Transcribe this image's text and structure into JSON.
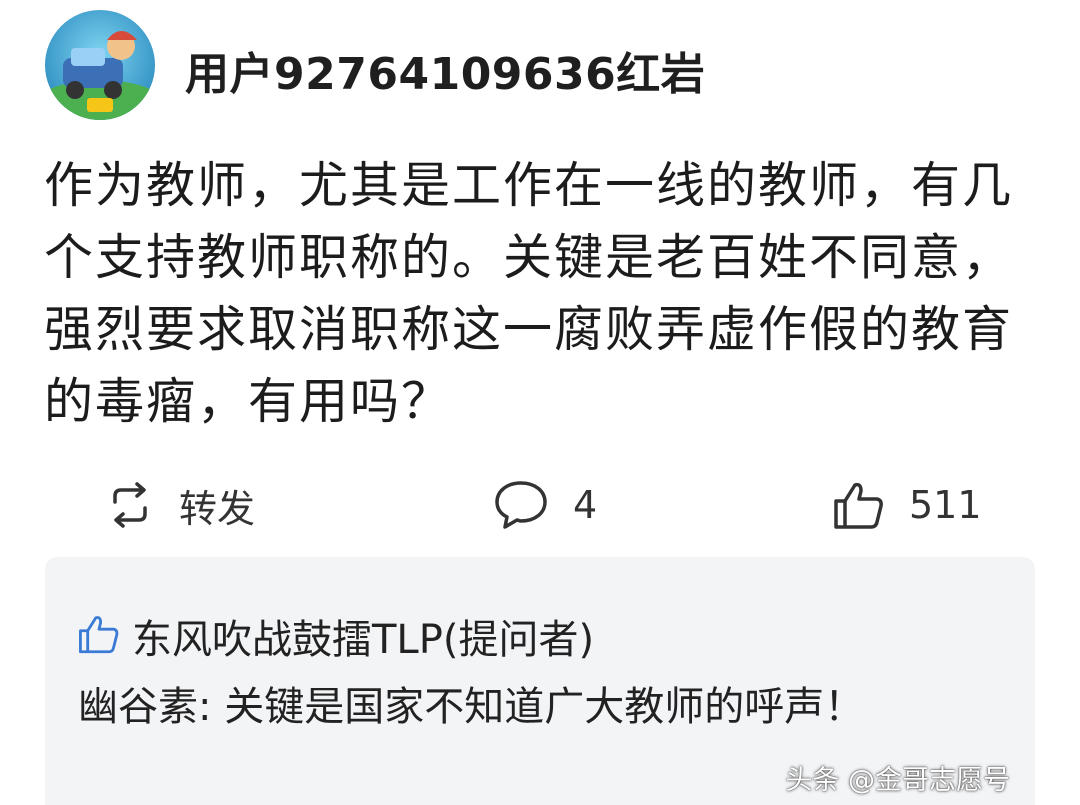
{
  "post": {
    "username": "用户92764109636红岩",
    "text": "作为教师，尤其是工作在一线的教师，有几个支持教师职称的。关键是老百姓不同意，强烈要求取消职称这一腐败弄虚作假的教育的毒瘤，有用吗？"
  },
  "actions": {
    "share_label": "转发",
    "comment_count": "4",
    "like_count": "511"
  },
  "reply": {
    "author": "东风吹战鼓擂TLP(提问者)",
    "text": "幽谷素: 关键是国家不知道广大教师的呼声！"
  },
  "watermark": "头条 @金哥志愿号",
  "colors": {
    "like_icon_blue": "#3a7bd5",
    "card_background": "#f3f4f6",
    "text": "#1c1c1c"
  }
}
